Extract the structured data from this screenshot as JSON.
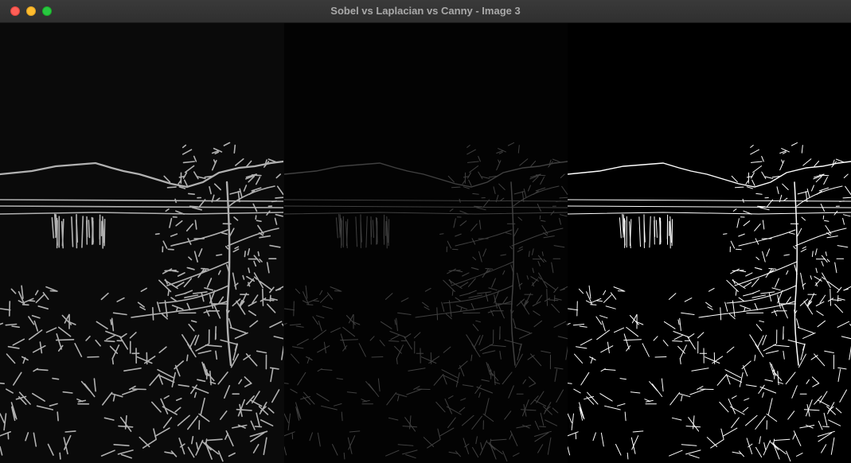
{
  "window": {
    "title": "Sobel vs Laplacian vs Canny - Image 3"
  },
  "panels": [
    {
      "name": "sobel",
      "stroke": "#cfcfcf",
      "background": "#0a0a0a"
    },
    {
      "name": "laplacian",
      "stroke": "#5a5a5a",
      "background": "#030303"
    },
    {
      "name": "canny",
      "stroke": "#ffffff",
      "background": "#000000"
    }
  ],
  "colors": {
    "titlebar": "#333333",
    "title_text": "#a9a9a9",
    "close": "#ff5f57",
    "minimize": "#febc2e",
    "maximize": "#28c840"
  }
}
